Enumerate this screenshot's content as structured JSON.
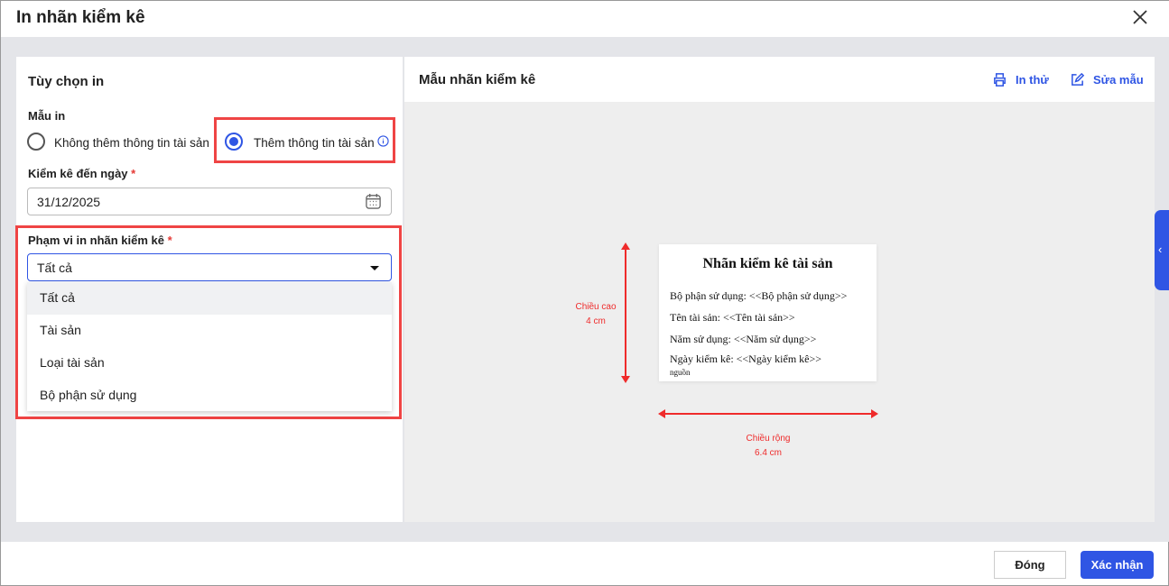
{
  "dialog": {
    "title": "In nhãn kiểm kê"
  },
  "options": {
    "heading": "Tùy chọn in",
    "template_label": "Mẫu in",
    "radio_no": "Không thêm thông tin tài sản",
    "radio_yes": "Thêm thông tin tài sản",
    "date_label": "Kiểm kê đến ngày",
    "date_value": "31/12/2025",
    "scope_label": "Phạm vi in nhãn kiểm kê",
    "scope_value": "Tất cả",
    "scope_options": [
      "Tất cả",
      "Tài sản",
      "Loại tài sản",
      "Bộ phận sử dụng"
    ],
    "required": "*"
  },
  "preview": {
    "heading": "Mẫu nhãn kiểm kê",
    "print_test": "In thử",
    "edit_template": "Sửa mẫu",
    "card_title": "Nhãn kiểm kê tài sản",
    "lines": [
      "Bộ phận sử dụng:  <<Bộ phận sử dụng>>",
      "Tên tài sản:  <<Tên tài sản>>",
      "Năm sử dụng:  <<Năm sử dụng>>",
      "Ngày kiểm kê:  <<Ngày kiểm kê>>"
    ],
    "cut_text": "nguồn",
    "height_label": "Chiều cao",
    "height_value": "4 cm",
    "width_label": "Chiều rộng",
    "width_value": "6.4 cm"
  },
  "footer": {
    "close": "Đóng",
    "confirm": "Xác nhận"
  },
  "colors": {
    "accent": "#2f55e4",
    "highlight": "#ef4444"
  }
}
